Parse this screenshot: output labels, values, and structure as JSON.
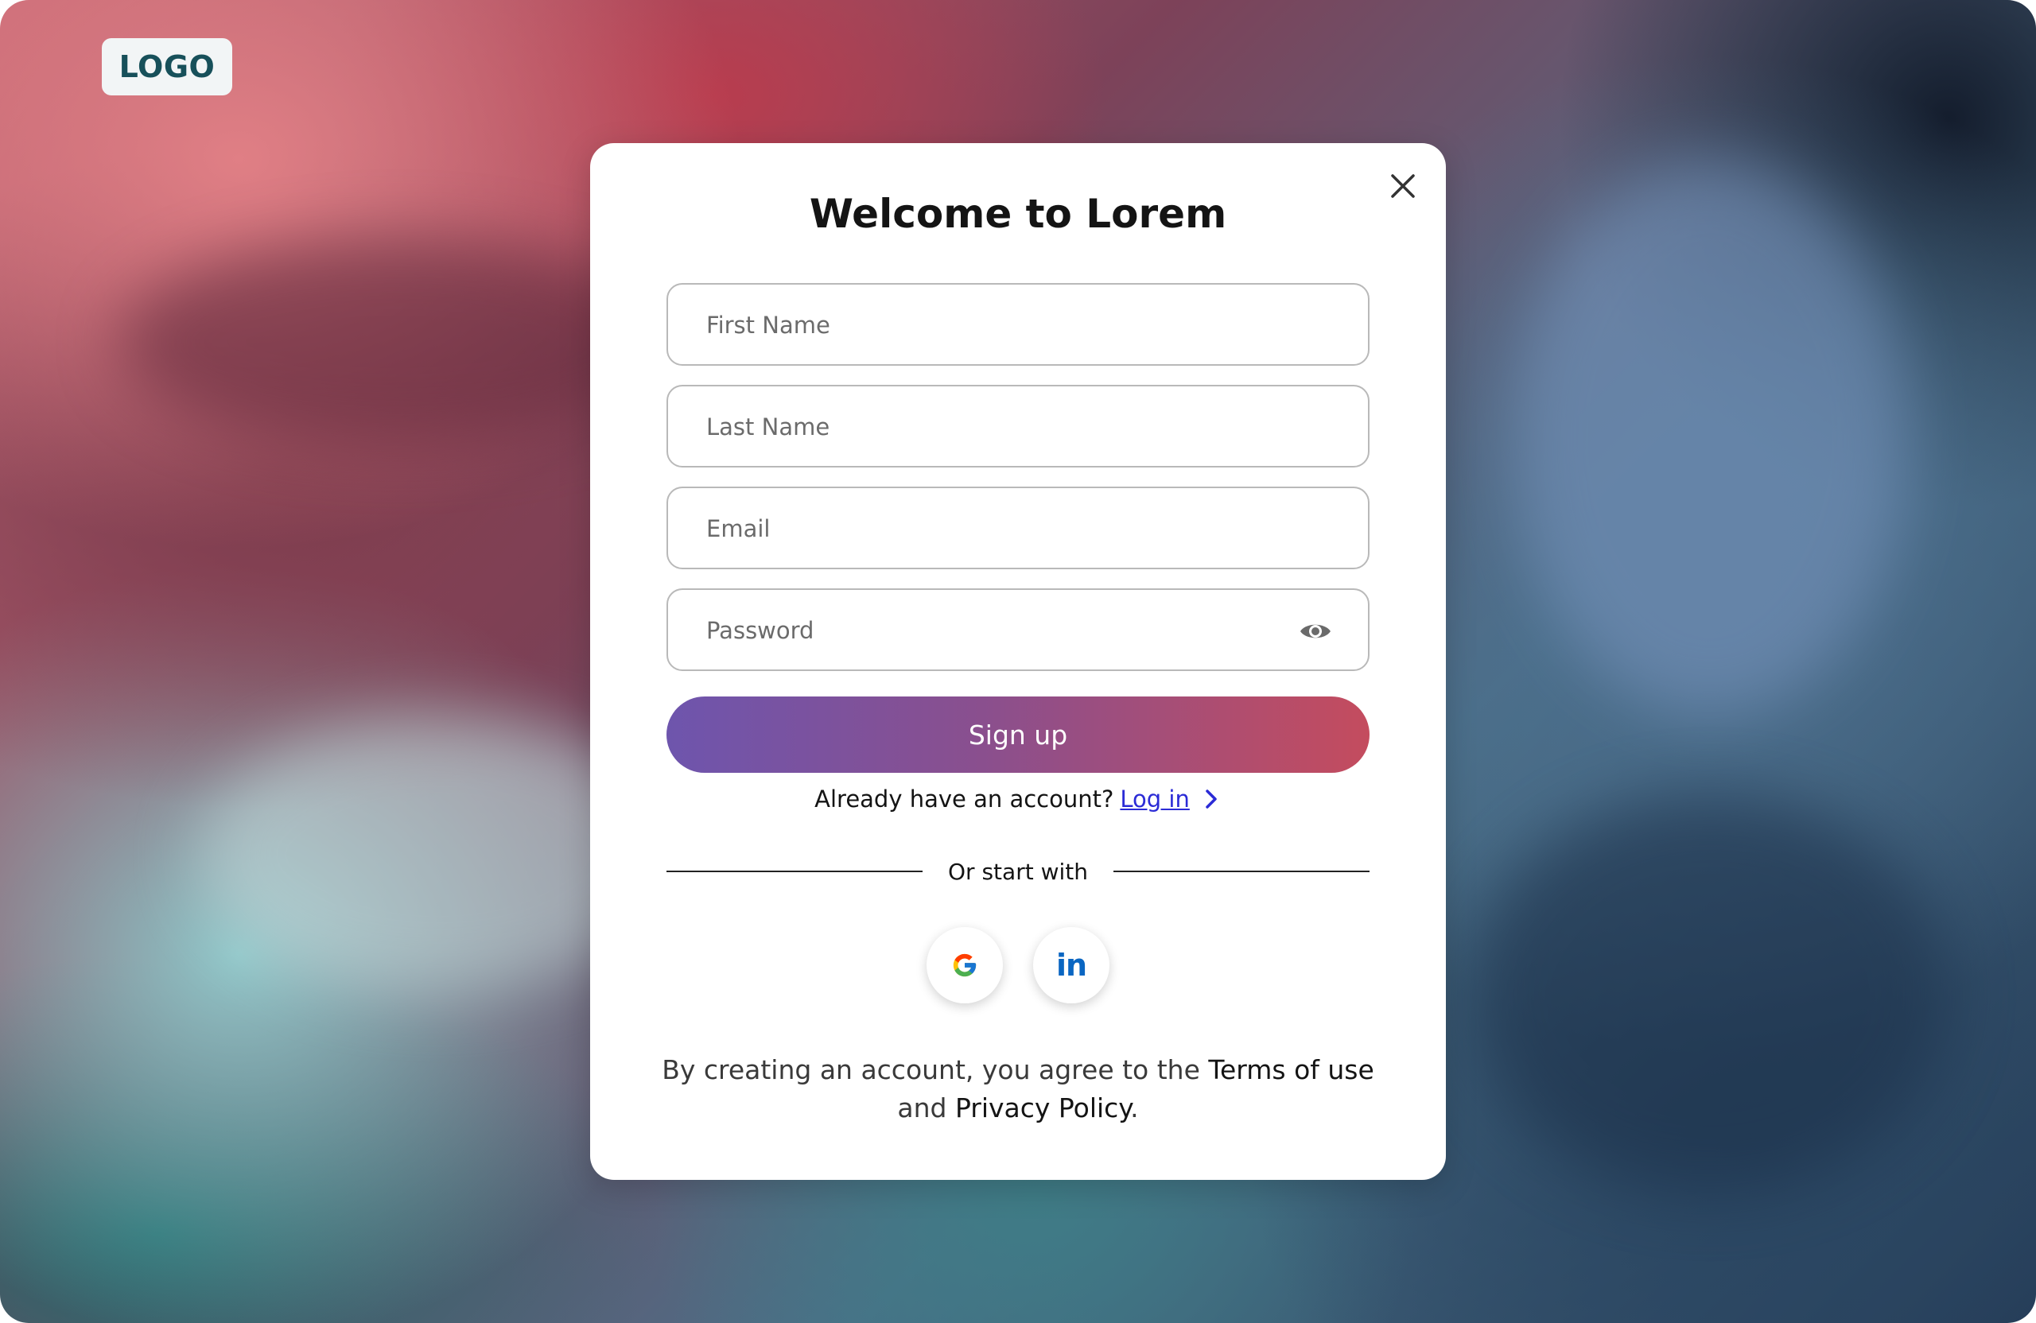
{
  "brand": {
    "logo_text": "LOGO"
  },
  "modal": {
    "title": "Welcome to Lorem",
    "close_icon": "close-icon",
    "fields": {
      "first_name_placeholder": "First Name",
      "last_name_placeholder": "Last Name",
      "email_placeholder": "Email",
      "password_placeholder": "Password"
    },
    "password_toggle_icon": "eye-icon",
    "signup_label": "Sign up",
    "login_prompt": "Already have an account?",
    "login_link": "Log in",
    "login_chevron_icon": "chevron-right-icon",
    "divider_text": "Or start with",
    "social": [
      {
        "name": "google",
        "icon": "google-icon"
      },
      {
        "name": "linkedin",
        "icon": "linkedin-icon",
        "text": "in"
      }
    ],
    "terms": {
      "prefix": "By creating an account, you agree to the",
      "terms_link": "Terms of use",
      "middle": "and",
      "privacy_link": "Privacy Policy",
      "suffix": "."
    }
  },
  "colors": {
    "signup_gradient_start": "#6e55ad",
    "signup_gradient_end": "#c44c5e",
    "link": "#2b2bd6",
    "logo_text": "#17505a",
    "linkedin": "#0a66c2"
  }
}
